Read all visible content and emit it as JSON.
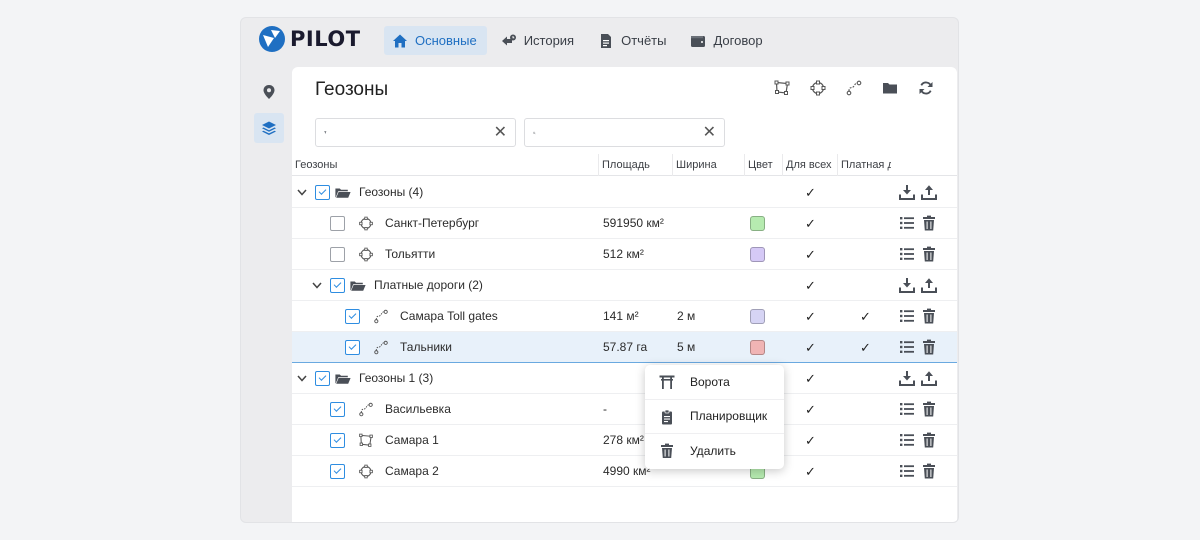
{
  "app": {
    "brand": "PILOT",
    "brand_color": "#1f6fc2"
  },
  "nav": [
    {
      "label": "Основные",
      "icon": "home-icon",
      "active": true
    },
    {
      "label": "История",
      "icon": "history-icon",
      "active": false
    },
    {
      "label": "Отчёты",
      "icon": "document-icon",
      "active": false
    },
    {
      "label": "Договор",
      "icon": "wallet-icon",
      "active": false
    }
  ],
  "sidebar": [
    {
      "icon": "map-pin-icon",
      "active": false
    },
    {
      "icon": "layers-icon",
      "active": true
    }
  ],
  "panel": {
    "title": "Геозоны",
    "tools": [
      "polygon-icon",
      "circle-zone-icon",
      "route-icon",
      "folder-icon",
      "refresh-icon"
    ],
    "filter_value": "",
    "search_value": ""
  },
  "table": {
    "columns": [
      "Геозоны",
      "Площадь",
      "Ширина",
      "Цвет",
      "Для всех",
      "Платная д"
    ],
    "rows": [
      {
        "type": "group",
        "name": "Геозоны (4)",
        "for_all": "✓",
        "paid": ""
      },
      {
        "type": "item",
        "icon": "circle-zone-icon",
        "name": "Санкт-Петербург",
        "area": "591950 км²",
        "width": "",
        "color": "#b6ebb0",
        "for_all": "✓",
        "paid": ""
      },
      {
        "type": "item",
        "icon": "circle-zone-icon",
        "name": "Тольятти",
        "area": "512 км²",
        "width": "",
        "color": "#d5c9f6",
        "for_all": "✓",
        "paid": ""
      },
      {
        "type": "group",
        "name": "Платные дороги (2)",
        "for_all": "✓",
        "paid": ""
      },
      {
        "type": "item",
        "icon": "route-icon",
        "name": "Самара Toll gates",
        "area": "141 м²",
        "width": "2 м",
        "color": "#d6d4f4",
        "for_all": "✓",
        "paid": "✓"
      },
      {
        "type": "item",
        "icon": "route-icon",
        "name": "Тальники",
        "area": "57.87 га",
        "width": "5 м",
        "color": "#f0b4b4",
        "for_all": "✓",
        "paid": "✓"
      },
      {
        "type": "group",
        "name": "Геозоны 1 (3)",
        "for_all": "✓",
        "paid": ""
      },
      {
        "type": "item",
        "icon": "route-icon",
        "name": "Васильевка",
        "area": "-",
        "width": "",
        "color": "",
        "for_all": "✓",
        "paid": ""
      },
      {
        "type": "item",
        "icon": "polygon-icon",
        "name": "Самара 1",
        "area": "278 км²",
        "width": "",
        "color": "",
        "for_all": "✓",
        "paid": ""
      },
      {
        "type": "item",
        "icon": "circle-zone-icon",
        "name": "Самара 2",
        "area": "4990 км²",
        "width": "",
        "color": "#b6ebb0",
        "for_all": "✓",
        "paid": ""
      }
    ]
  },
  "context_menu": [
    {
      "label": "Ворота",
      "icon": "gate-icon"
    },
    {
      "label": "Планировщик",
      "icon": "clipboard-icon"
    },
    {
      "label": "Удалить",
      "icon": "trash-icon"
    }
  ]
}
